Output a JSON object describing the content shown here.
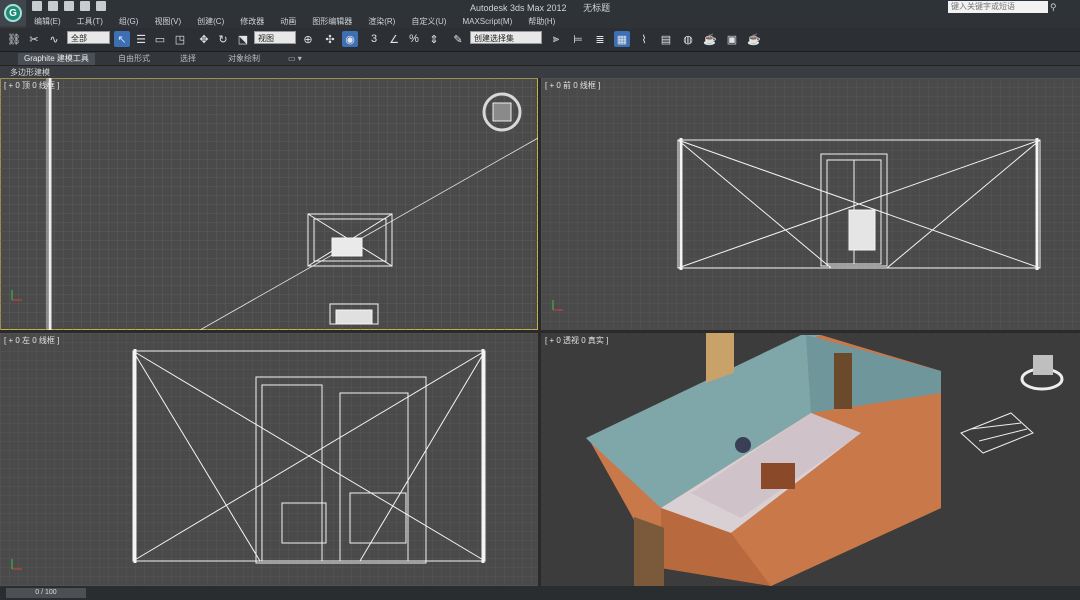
{
  "window": {
    "title": "Autodesk 3ds Max  2012",
    "file": "无标题",
    "search_placeholder": "键入关键字或短语"
  },
  "app_button": {
    "label": "G"
  },
  "menu": [
    {
      "label": "编辑(E)"
    },
    {
      "label": "工具(T)"
    },
    {
      "label": "组(G)"
    },
    {
      "label": "视图(V)"
    },
    {
      "label": "创建(C)"
    },
    {
      "label": "修改器"
    },
    {
      "label": "动画"
    },
    {
      "label": "图形编辑器"
    },
    {
      "label": "渲染(R)"
    },
    {
      "label": "自定义(U)"
    },
    {
      "label": "MAXScript(M)"
    },
    {
      "label": "帮助(H)"
    }
  ],
  "toolbar": {
    "selection_filter": "全部",
    "ref_coord": "视图",
    "named_selection": "创建选择集"
  },
  "ribbon": {
    "tabs": [
      {
        "label": "Graphite 建模工具"
      },
      {
        "label": "自由形式"
      },
      {
        "label": "选择"
      },
      {
        "label": "对象绘制"
      }
    ],
    "sub_label": "多边形建模"
  },
  "viewports": {
    "top_left": {
      "label": "[ + 0 顶 0 线框 ]"
    },
    "top_right": {
      "label": "[ + 0 前 0 线框 ]"
    },
    "bottom_left": {
      "label": "[ + 0 左 0 线框 ]"
    },
    "bottom_right": {
      "label": "[ + 0 透视 0 真实 ]"
    }
  },
  "timeline": {
    "position": "0 / 100"
  },
  "colors": {
    "viewport_bg": "#4a4a4a",
    "grid": "#5f5f5f",
    "wire": "#f2f2f2",
    "active_border": "#c9b04a",
    "wall_orange": "#c9784a",
    "wall_blue": "#7fa6a8"
  }
}
